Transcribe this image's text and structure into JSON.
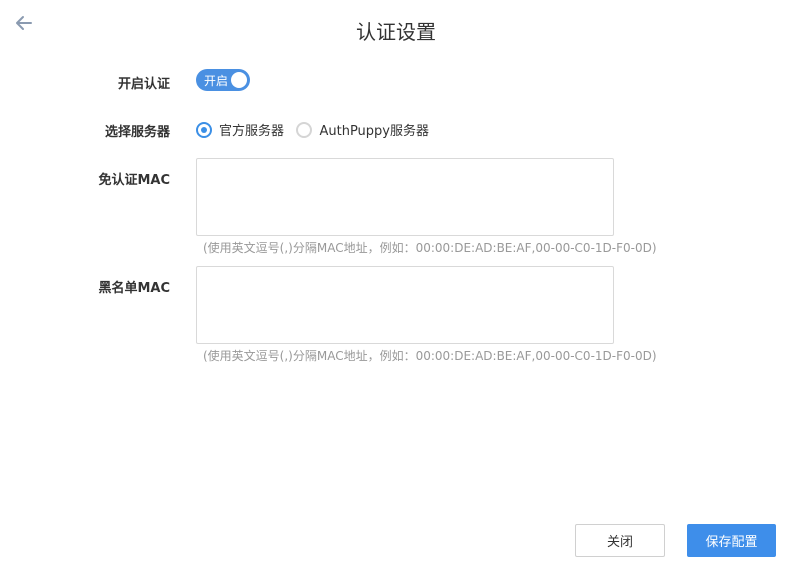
{
  "header": {
    "title": "认证设置"
  },
  "form": {
    "auth_toggle": {
      "label": "开启认证",
      "state_text": "开启",
      "on": true
    },
    "server_select": {
      "label": "选择服务器",
      "options": [
        {
          "label": "官方服务器",
          "checked": true
        },
        {
          "label": "AuthPuppy服务器",
          "checked": false
        }
      ]
    },
    "whitelist_mac": {
      "label": "免认证MAC",
      "value": "",
      "hint": "(使用英文逗号(,)分隔MAC地址，例如：00:00:DE:AD:BE:AF,00-00-C0-1D-F0-0D)"
    },
    "blacklist_mac": {
      "label": "黑名单MAC",
      "value": "",
      "hint": "(使用英文逗号(,)分隔MAC地址，例如：00:00:DE:AD:BE:AF,00-00-C0-1D-F0-0D)"
    }
  },
  "footer": {
    "close_label": "关闭",
    "save_label": "保存配置"
  },
  "colors": {
    "accent": "#3e8eea",
    "toggle_on": "#4a90e2",
    "hint_text": "#999999"
  },
  "icons": {
    "back": "arrow-left-icon"
  }
}
